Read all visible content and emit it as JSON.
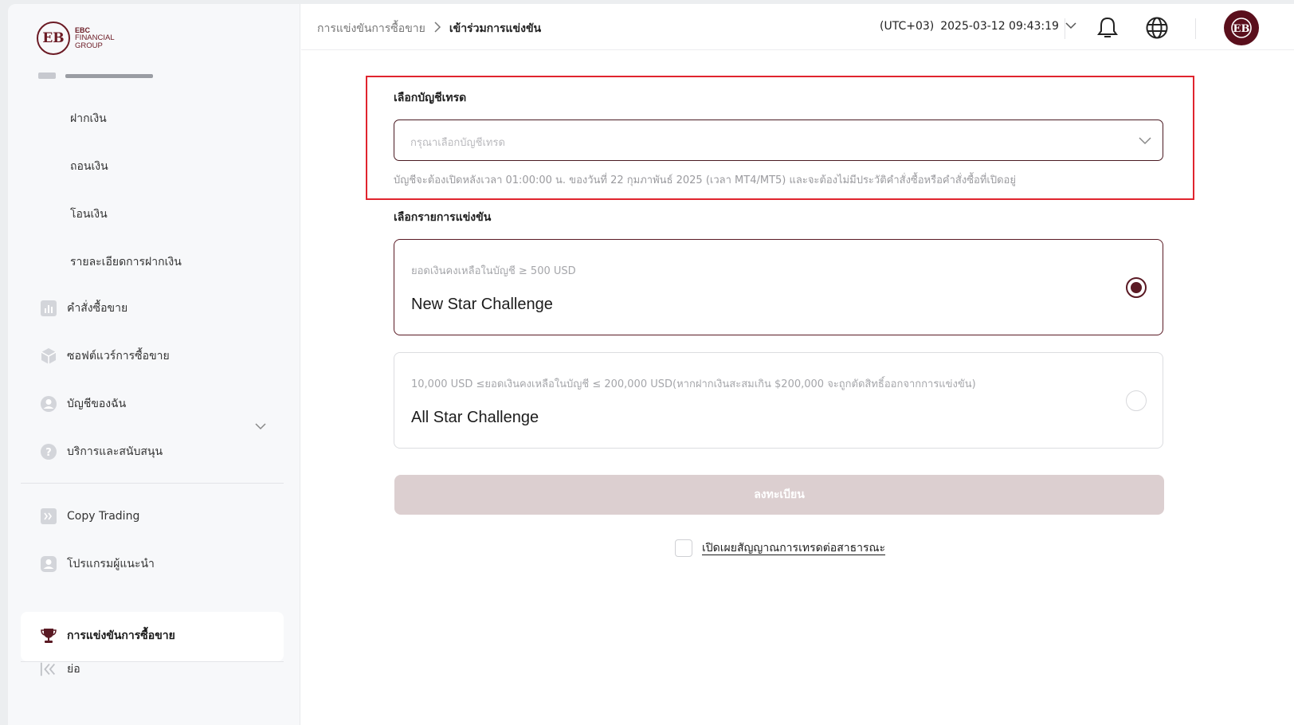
{
  "brand": {
    "logo_letters": "EB",
    "name_line1": "EBC",
    "name_line2": "FINANCIAL",
    "name_line3": "GROUP"
  },
  "sidebar": {
    "sub_items": [
      {
        "label": "ฝากเงิน"
      },
      {
        "label": "ถอนเงิน"
      },
      {
        "label": "โอนเงิน"
      },
      {
        "label": "รายละเอียดการฝากเงิน"
      }
    ],
    "items": [
      {
        "label": "คำสั่งซื้อขาย",
        "icon": "chart-bar-icon"
      },
      {
        "label": "ซอฟต์แวร์การซื้อขาย",
        "icon": "cube-icon"
      },
      {
        "label": "บัญชีของฉัน",
        "icon": "user-circle-icon"
      },
      {
        "label": "บริการและสนับสนุน",
        "icon": "help-circle-icon"
      },
      {
        "label": "Copy Trading",
        "icon": "copy-trading-icon"
      },
      {
        "label": "โปรแกรมผู้แนะนำ",
        "icon": "referral-icon"
      },
      {
        "label": "การแข่งขันการซื้อขาย",
        "icon": "trophy-icon"
      },
      {
        "label": "ย่อ",
        "icon": "collapse-icon"
      }
    ]
  },
  "header": {
    "breadcrumb_parent": "การแข่งขันการซื้อขาย",
    "breadcrumb_current": "เข้าร่วมการแข่งขัน",
    "timezone": "(UTC+03)",
    "datetime": "2025-03-12 09:43:19"
  },
  "form": {
    "account_label": "เลือกบัญชีเทรด",
    "account_placeholder": "กรุณาเลือกบัญชีเทรด",
    "account_hint": "บัญชีจะต้องเปิดหลังเวลา 01:00:00 น. ของวันที่ 22 กุมภาพันธ์ 2025 (เวลา MT4/MT5) และจะต้องไม่มีประวัติคำสั่งซื้อหรือคำสั่งซื้อที่เปิดอยู่",
    "competition_label": "เลือกรายการแข่งขัน",
    "options": [
      {
        "subtitle": "ยอดเงินคงเหลือในบัญชี ≥ 500 USD",
        "title": "New Star Challenge",
        "selected": true
      },
      {
        "subtitle": "10,000 USD ≤ยอดเงินคงเหลือในบัญชี ≤ 200,000 USD(หากฝากเงินสะสมเกิน $200,000 จะถูกตัดสิทธิ์ออกจากการแข่งขัน)",
        "title": "All Star Challenge",
        "selected": false
      }
    ],
    "submit_label": "ลงทะเบียน",
    "disclose_label": "เปิดเผยสัญญาณการเทรดต่อสาธารณะ"
  },
  "colors": {
    "brand": "#5a1a24",
    "highlight_border": "#e0242e",
    "button_disabled": "#dccfd0"
  }
}
